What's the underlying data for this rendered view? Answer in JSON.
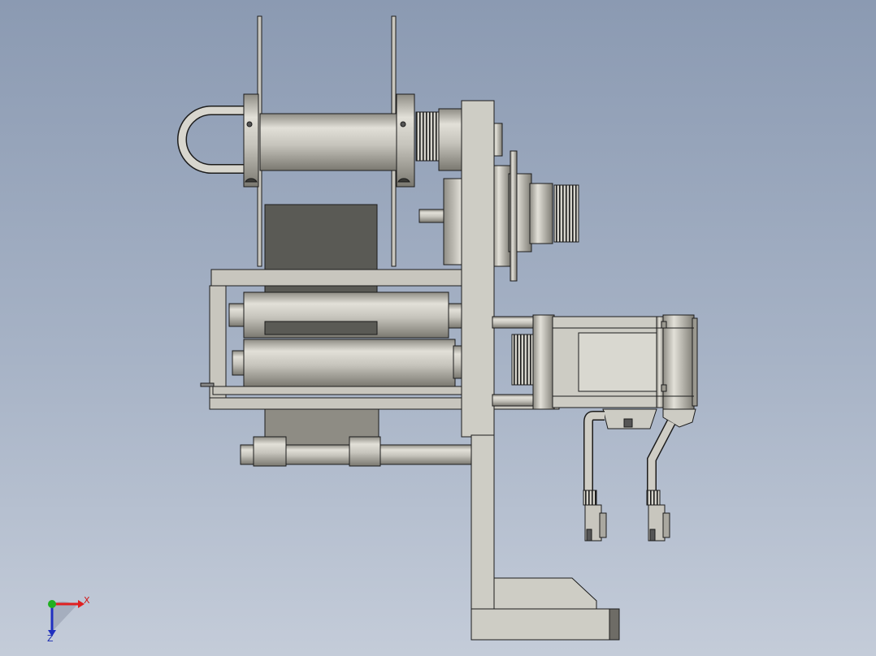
{
  "viewport": {
    "background_top": "#8b9ab2",
    "background_bottom": "#c4ccd9",
    "part_color": "#c8c6be",
    "edge_color": "#1c1c1c",
    "dark_panel_color": "#5a5a55"
  },
  "triad": {
    "x_label": "X",
    "z_label": "Z",
    "x_color": "#e02020",
    "y_color": "#20b020",
    "z_color": "#2030c0"
  }
}
